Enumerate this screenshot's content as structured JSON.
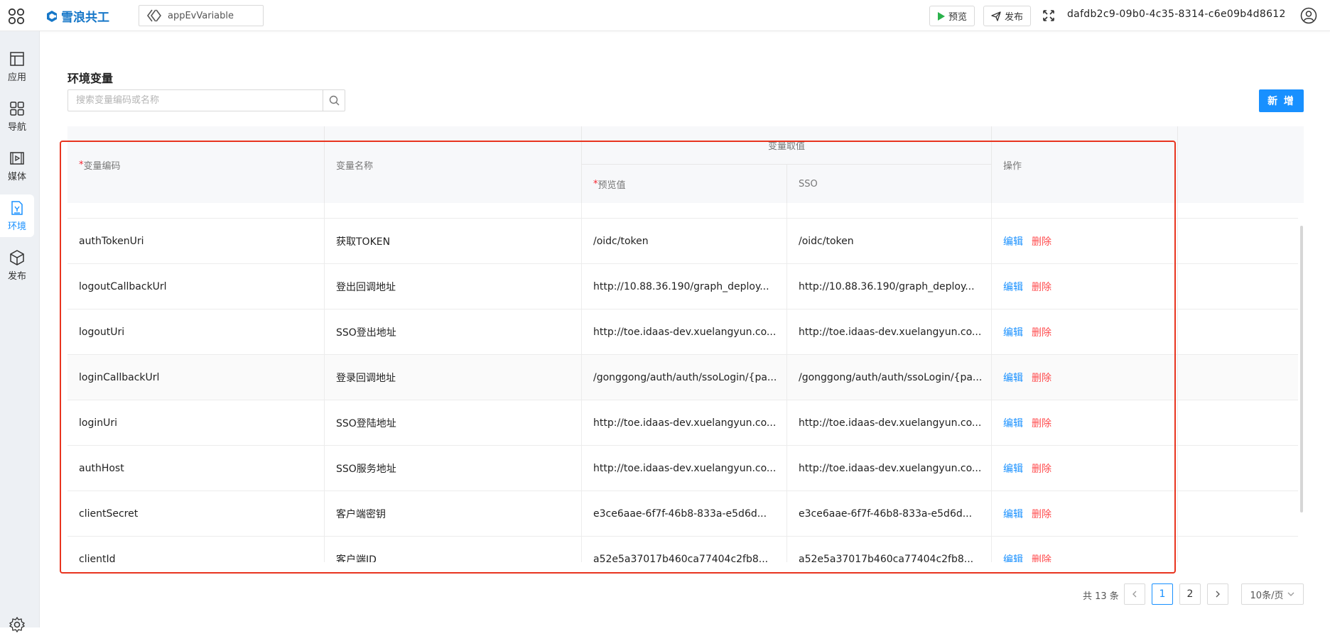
{
  "header": {
    "brand": "雪浪共工",
    "app_selector": "appEvVariable",
    "preview_label": "预览",
    "publish_label": "发布",
    "app_id": "dafdb2c9-09b0-4c35-8314-c6e09b4d8612"
  },
  "sidebar": {
    "items": [
      {
        "label": "应用",
        "icon": "layout-icon"
      },
      {
        "label": "导航",
        "icon": "grid-icon"
      },
      {
        "label": "媒体",
        "icon": "media-icon"
      },
      {
        "label": "环境",
        "icon": "env-icon",
        "active": true
      },
      {
        "label": "发布",
        "icon": "package-icon"
      }
    ]
  },
  "main": {
    "title": "环境变量",
    "search_placeholder": "搜索变量编码或名称",
    "add_label": "新 增"
  },
  "table": {
    "headers": {
      "code": "变量编码",
      "name": "变量名称",
      "value_group": "变量取值",
      "preview": "预览值",
      "sso": "SSO",
      "action": "操作"
    },
    "edit_label": "编辑",
    "delete_label": "删除",
    "rows": [
      {
        "code": "authTokenUri",
        "name": "获取TOKEN",
        "preview": "/oidc/token",
        "sso": "/oidc/token"
      },
      {
        "code": "logoutCallbackUrl",
        "name": "登出回调地址",
        "preview": "http://10.88.36.190/graph_deploy...",
        "sso": "http://10.88.36.190/graph_deploy..."
      },
      {
        "code": "logoutUri",
        "name": "SSO登出地址",
        "preview": "http://toe.idaas-dev.xuelangyun.co...",
        "sso": "http://toe.idaas-dev.xuelangyun.co..."
      },
      {
        "code": "loginCallbackUrl",
        "name": "登录回调地址",
        "preview": "/gonggong/auth/auth/ssoLogin/{pa...",
        "sso": "/gonggong/auth/auth/ssoLogin/{pa..."
      },
      {
        "code": "loginUri",
        "name": "SSO登陆地址",
        "preview": "http://toe.idaas-dev.xuelangyun.co...",
        "sso": "http://toe.idaas-dev.xuelangyun.co..."
      },
      {
        "code": "authHost",
        "name": "SSO服务地址",
        "preview": "http://toe.idaas-dev.xuelangyun.co...",
        "sso": "http://toe.idaas-dev.xuelangyun.co..."
      },
      {
        "code": "clientSecret",
        "name": "客户端密钥",
        "preview": "e3ce6aae-6f7f-46b8-833a-e5d6d...",
        "sso": "e3ce6aae-6f7f-46b8-833a-e5d6d..."
      },
      {
        "code": "clientId",
        "name": "客户端ID",
        "preview": "a52e5a37017b460ca77404c2fb8...",
        "sso": "a52e5a37017b460ca77404c2fb8..."
      }
    ]
  },
  "pagination": {
    "total": "共 13 条",
    "pages": [
      "1",
      "2"
    ],
    "current": "1",
    "page_size": "10条/页"
  },
  "colors": {
    "primary": "#1890ff",
    "danger": "#ff4d4f",
    "highlight": "#e8341f"
  }
}
